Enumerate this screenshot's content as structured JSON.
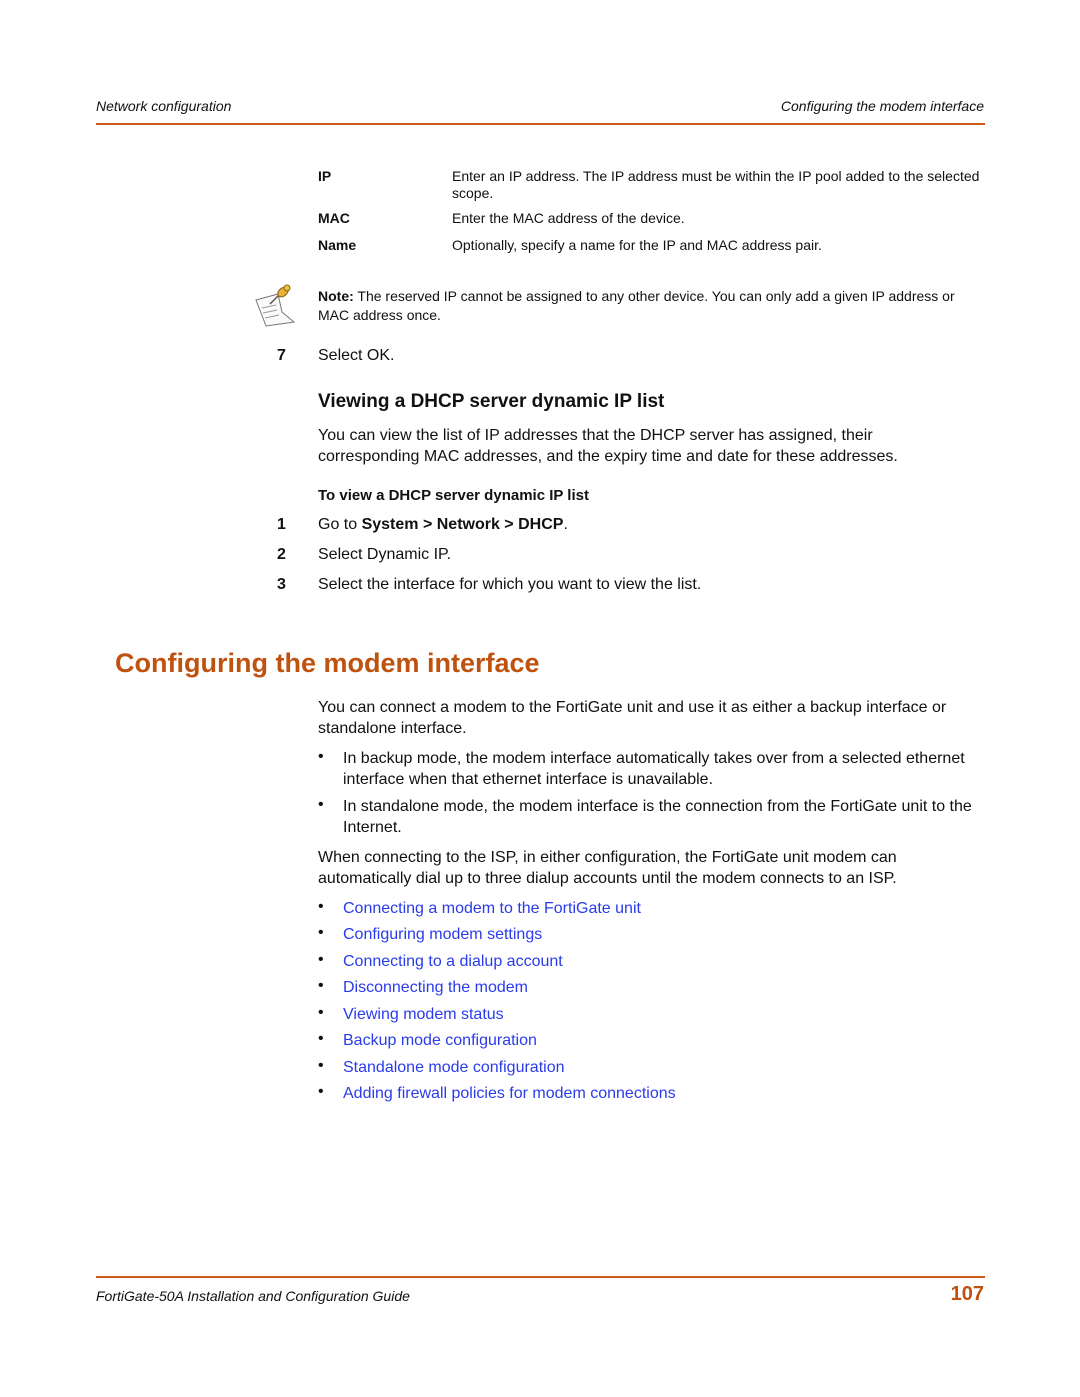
{
  "header": {
    "left": "Network configuration",
    "right": "Configuring the modem interface"
  },
  "definitions": [
    {
      "term": "IP",
      "desc": "Enter an IP address. The IP address must be within the IP pool added to the selected scope."
    },
    {
      "term": "MAC",
      "desc": "Enter the MAC address of the device."
    },
    {
      "term": "Name",
      "desc": "Optionally, specify a name for the IP and MAC address pair."
    }
  ],
  "note": {
    "icon": "note-pin-icon",
    "label": "Note:",
    "text": " The reserved IP cannot be assigned to any other device. You can only add a given IP address or MAC address once."
  },
  "step7": {
    "num": "7",
    "text": "Select OK."
  },
  "section_dhcp": {
    "heading": "Viewing a DHCP server dynamic IP list",
    "intro": "You can view the list of IP addresses that the DHCP server has assigned, their corresponding MAC addresses, and the expiry time and date for these addresses.",
    "procedure_title": "To view a DHCP server dynamic IP list",
    "steps": [
      {
        "num": "1",
        "prefix": "Go to ",
        "bold": "System > Network > DHCP",
        "suffix": "."
      },
      {
        "num": "2",
        "text": "Select Dynamic IP."
      },
      {
        "num": "3",
        "text": "Select the interface for which you want to view the list."
      }
    ]
  },
  "section_modem": {
    "heading": "Configuring the modem interface",
    "intro": "You can connect a modem to the FortiGate unit and use it as either a backup interface or standalone interface.",
    "bullets": [
      "In backup mode, the modem interface automatically takes over from a selected ethernet interface when that ethernet interface is unavailable.",
      "In standalone mode, the modem interface is the connection from the FortiGate unit to the Internet."
    ],
    "para2": "When connecting to the ISP, in either configuration, the FortiGate unit modem can automatically dial up to three dialup accounts until the modem connects to an ISP.",
    "links": [
      "Connecting a modem to the FortiGate unit",
      "Configuring modem settings",
      "Connecting to a dialup account",
      "Disconnecting the modem",
      "Viewing modem status",
      "Backup mode configuration",
      "Standalone mode configuration",
      "Adding firewall policies for modem connections"
    ]
  },
  "footer": {
    "title": "FortiGate-50A Installation and Configuration Guide",
    "page_number": "107"
  },
  "colors": {
    "accent": "#c0520f",
    "rule": "#cc5a1a",
    "link": "#2a3bea"
  }
}
